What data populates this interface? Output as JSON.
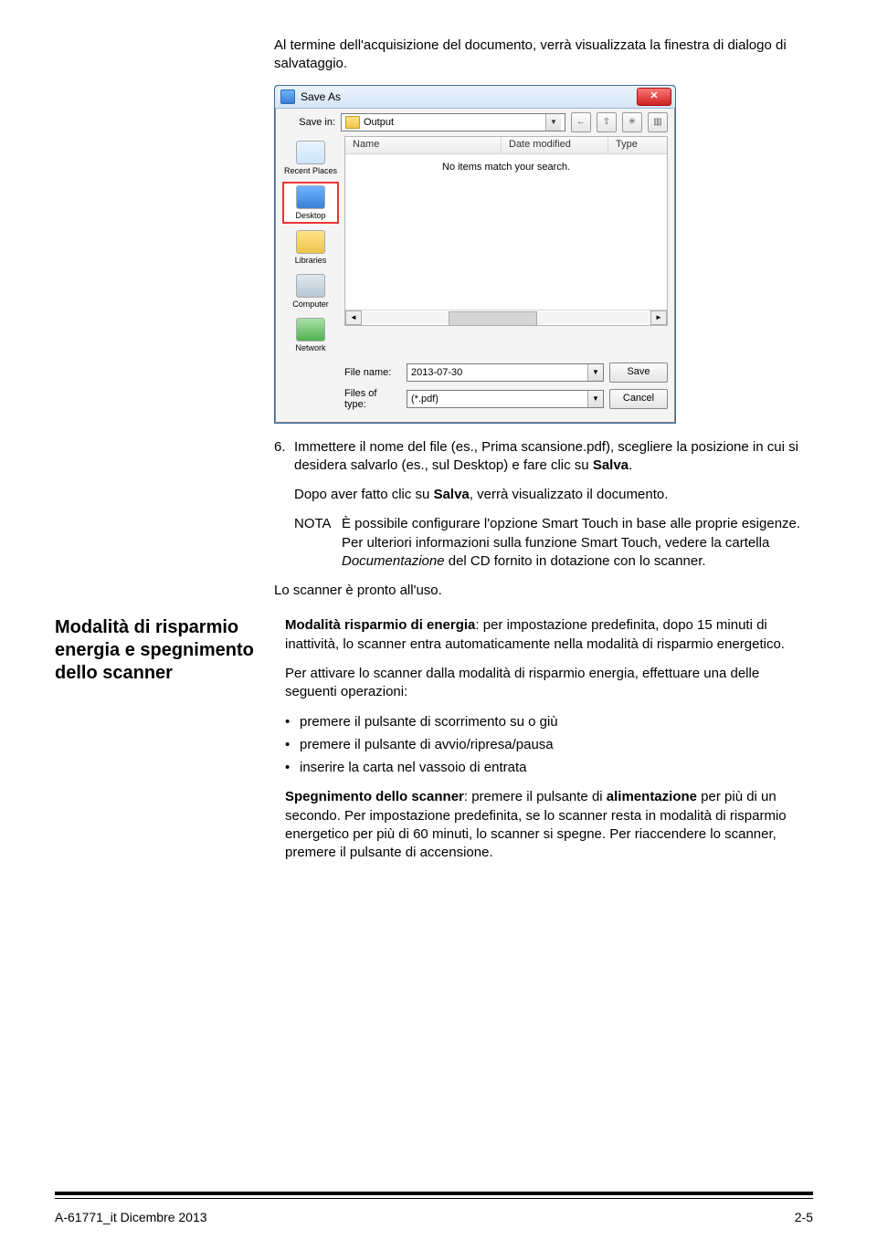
{
  "intro_para": "Al termine dell'acquisizione del documento, verrà visualizzata la finestra di dialogo di salvataggio.",
  "dialog": {
    "title": "Save As",
    "save_in_label": "Save in:",
    "save_in_value": "Output",
    "cols": {
      "name": "Name",
      "date": "Date modified",
      "type": "Type"
    },
    "empty_msg": "No items match your search.",
    "places": {
      "recent": "Recent Places",
      "desktop": "Desktop",
      "libraries": "Libraries",
      "computer": "Computer",
      "network": "Network"
    },
    "file_name_label": "File name:",
    "file_name_value": "2013-07-30",
    "file_type_label": "Files of type:",
    "file_type_value": "(*.pdf)",
    "save_btn": "Save",
    "cancel_btn": "Cancel"
  },
  "step6": {
    "num": "6.",
    "text_a": "Immettere il nome del file (es., Prima scansione.pdf), scegliere la posizione in cui si desidera salvarlo (es., sul Desktop) e fare clic su ",
    "salva": "Salva",
    "text_b": ".",
    "after1_a": "Dopo aver fatto clic su ",
    "after1_b": ", verrà visualizzato il documento.",
    "nota_label": "NOTA",
    "nota_body_a": "È possibile configurare l'opzione Smart Touch in base alle proprie esigenze. Per ulteriori informazioni sulla funzione Smart Touch, vedere la cartella ",
    "nota_body_i": "Documentazione",
    "nota_body_b": " del CD fornito in dotazione con lo scanner."
  },
  "ready": "Lo scanner è pronto all'uso.",
  "section": {
    "heading": "Modalità di risparmio energia e spegnimento dello scanner",
    "p1_a": "Modalità risparmio di energia",
    "p1_b": ": per impostazione predefinita, dopo 15 minuti di inattività, lo scanner entra automaticamente nella modalità di risparmio energetico.",
    "p2": "Per attivare lo scanner dalla modalità di risparmio energia, effettuare una delle seguenti operazioni:",
    "bullets": [
      "premere il pulsante di scorrimento su o giù",
      "premere il pulsante di avvio/ripresa/pausa",
      "inserire la carta nel vassoio di entrata"
    ],
    "p3_a": "Spegnimento dello scanner",
    "p3_b": ": premere il pulsante di ",
    "p3_c": "alimentazione",
    "p3_d": " per più di un secondo. Per impostazione predefinita, se lo scanner resta in modalità di risparmio energetico per più di 60 minuti, lo scanner si spegne. Per riaccendere lo scanner, premere il pulsante di accensione."
  },
  "footer": {
    "left": "A-61771_it  Dicembre 2013",
    "right": "2-5"
  }
}
